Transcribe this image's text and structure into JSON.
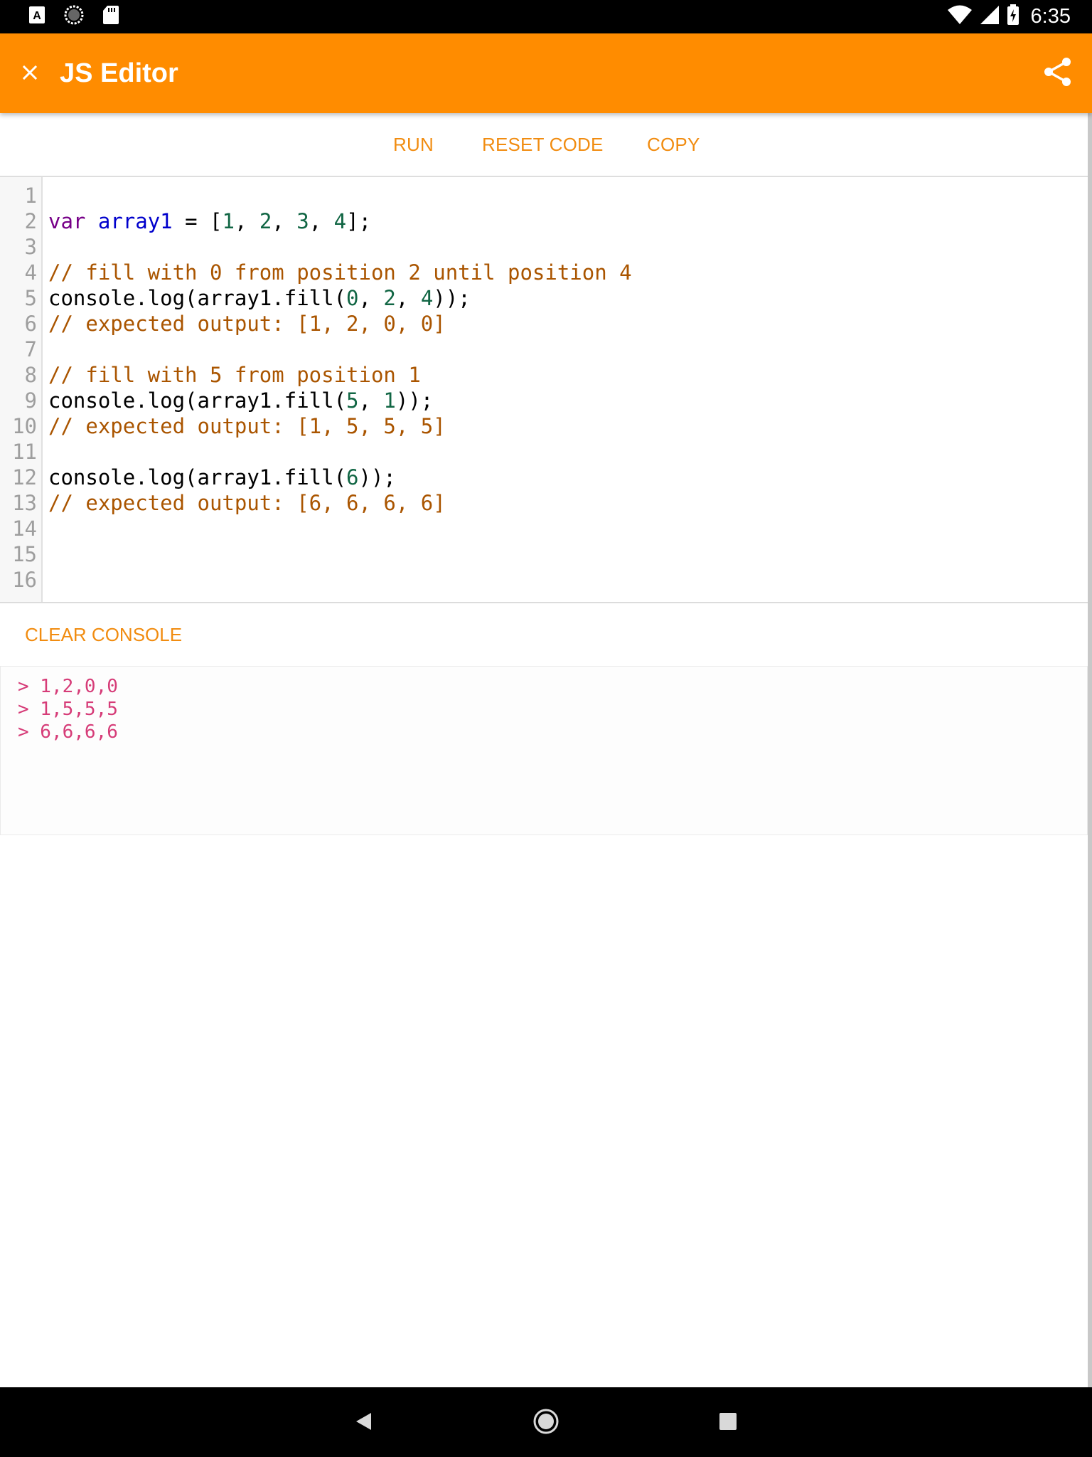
{
  "status_bar": {
    "time": "6:35",
    "left_icons": [
      "text-a-icon",
      "circle-loading-icon",
      "sd-card-icon"
    ],
    "right_icons": [
      "wifi-icon",
      "cell-signal-icon",
      "battery-charging-icon"
    ]
  },
  "app_bar": {
    "title": "JS Editor",
    "close_icon": "close-icon",
    "share_icon": "share-icon",
    "background": "#ff8c00"
  },
  "toolbar": {
    "run_label": "RUN",
    "reset_label": "RESET CODE",
    "copy_label": "COPY",
    "accent": "#f18c10"
  },
  "editor": {
    "line_numbers": [
      "1",
      "2",
      "3",
      "4",
      "5",
      "6",
      "7",
      "8",
      "9",
      "10",
      "11",
      "12",
      "13",
      "14",
      "15",
      "16"
    ],
    "lines": [
      [],
      [
        {
          "t": "var",
          "c": "keyword"
        },
        {
          "t": " ",
          "c": "plain"
        },
        {
          "t": "array1",
          "c": "def"
        },
        {
          "t": " = [",
          "c": "plain"
        },
        {
          "t": "1",
          "c": "number"
        },
        {
          "t": ", ",
          "c": "plain"
        },
        {
          "t": "2",
          "c": "number"
        },
        {
          "t": ", ",
          "c": "plain"
        },
        {
          "t": "3",
          "c": "number"
        },
        {
          "t": ", ",
          "c": "plain"
        },
        {
          "t": "4",
          "c": "number"
        },
        {
          "t": "];",
          "c": "plain"
        }
      ],
      [],
      [
        {
          "t": "// fill with 0 from position 2 until position 4",
          "c": "comment"
        }
      ],
      [
        {
          "t": "console.log(array1.fill(",
          "c": "plain"
        },
        {
          "t": "0",
          "c": "number"
        },
        {
          "t": ", ",
          "c": "plain"
        },
        {
          "t": "2",
          "c": "number"
        },
        {
          "t": ", ",
          "c": "plain"
        },
        {
          "t": "4",
          "c": "number"
        },
        {
          "t": "));",
          "c": "plain"
        }
      ],
      [
        {
          "t": "// expected output: [1, 2, 0, 0]",
          "c": "comment"
        }
      ],
      [],
      [
        {
          "t": "// fill with 5 from position 1",
          "c": "comment"
        }
      ],
      [
        {
          "t": "console.log(array1.fill(",
          "c": "plain"
        },
        {
          "t": "5",
          "c": "number"
        },
        {
          "t": ", ",
          "c": "plain"
        },
        {
          "t": "1",
          "c": "number"
        },
        {
          "t": "));",
          "c": "plain"
        }
      ],
      [
        {
          "t": "// expected output: [1, 5, 5, 5]",
          "c": "comment"
        }
      ],
      [],
      [
        {
          "t": "console.log(array1.fill(",
          "c": "plain"
        },
        {
          "t": "6",
          "c": "number"
        },
        {
          "t": "));",
          "c": "plain"
        }
      ],
      [
        {
          "t": "// expected output: [6, 6, 6, 6]",
          "c": "comment"
        }
      ],
      [],
      [],
      []
    ]
  },
  "console": {
    "clear_label": "CLEAR CONSOLE",
    "output": [
      "> 1,2,0,0",
      "> 1,5,5,5",
      "> 6,6,6,6"
    ],
    "output_color": "#d63c78"
  },
  "nav_bar": {
    "icons": [
      "back-icon",
      "home-icon",
      "recent-apps-icon"
    ]
  }
}
